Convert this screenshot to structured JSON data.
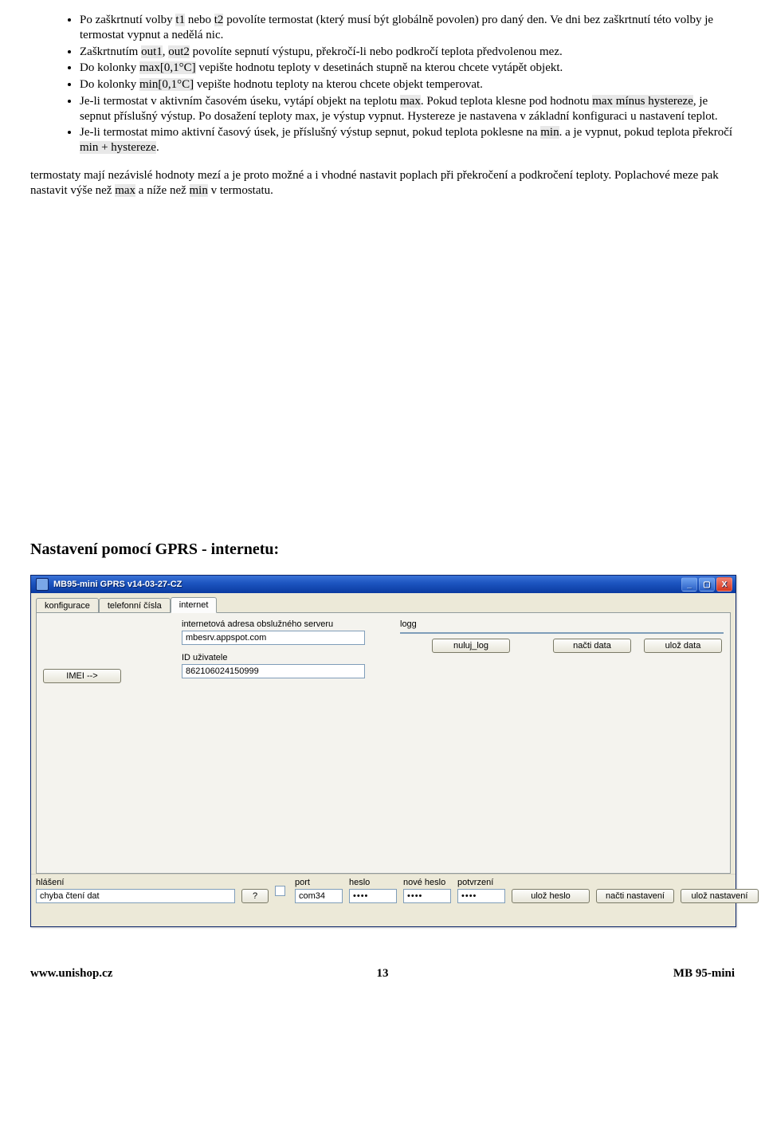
{
  "bullets": [
    {
      "pre": "Po zaškrtnutí volby ",
      "h1": "t1",
      "mid1": " nebo ",
      "h2": "t2",
      "post": " povolíte termostat (který musí být globálně povolen) pro daný den. Ve dni bez zaškrtnutí této volby je termostat vypnut a nedělá nic."
    },
    {
      "pre": "Zaškrtnutím ",
      "h1": "out1",
      "mid1": ", ",
      "h2": "out2",
      "post": " povolíte sepnutí výstupu, překročí-li nebo podkročí teplota předvolenou mez."
    },
    {
      "pre": "Do kolonky ",
      "h1": "max[0,1°C]",
      "post": " vepište hodnotu teploty v desetinách stupně na kterou chcete vytápět objekt."
    },
    {
      "pre": "Do kolonky ",
      "h1": "min[0,1°C]",
      "post": " vepište hodnotu teploty na kterou chcete objekt temperovat."
    },
    {
      "pre": "Je-li termostat v aktivním časovém úseku, vytápí objekt na teplotu  ",
      "h1": "max",
      "mid1": ". Pokud teplota klesne pod hodnotu ",
      "h2": "max mínus hystereze",
      "post": ", je sepnut příslušný výstup. Po dosažení teploty max, je výstup vypnut. Hystereze je nastavena v základní konfiguraci u nastavení teplot."
    },
    {
      "pre": "Je-li termostat mimo aktivní časový úsek, je příslušný výstup sepnut, pokud teplota poklesne na ",
      "h1": "min",
      "mid1": ". a je vypnut, pokud teplota překročí ",
      "h2": "min + hystereze",
      "post": "."
    }
  ],
  "paragraph": {
    "pre": "termostaty mají nezávislé hodnoty mezí a je proto možné a i vhodné nastavit poplach při překročení a podkročení teploty. Poplachové meze pak nastavit výše než ",
    "h1": "max",
    "mid": " a níže než ",
    "h2": "min",
    "post": " v termostatu."
  },
  "heading": "Nastavení  pomocí GPRS - internetu:",
  "win": {
    "title": "MB95-mini GPRS v14-03-27-CZ",
    "tabs": {
      "konfigurace": "konfigurace",
      "telefon": "telefonní čísla",
      "internet": "internet"
    },
    "server_label": "internetová adresa obslužného serveru",
    "server_value": "mbesrv.appspot.com",
    "id_label": "ID uživatele",
    "id_value": "862106024150999",
    "imei_btn": "IMEI -->",
    "logg_label": "logg",
    "nuluj_log": "nuluj_log",
    "nacti_data": "načti data",
    "uloz_data": "ulož data",
    "hlaseni_lbl": "hlášení",
    "hlaseni_val": "chyba čtení dat",
    "q": "?",
    "port_lbl": "port",
    "port_val": "com34",
    "heslo_lbl": "heslo",
    "nove_heslo_lbl": "nové heslo",
    "potvrzeni_lbl": "potvrzení",
    "uloz_heslo": "ulož heslo",
    "nacti_nast": "načti nastavení",
    "uloz_nast": "ulož nastavení"
  },
  "footer": {
    "left": "www.unishop.cz",
    "center": "13",
    "right": "MB 95-mini"
  }
}
